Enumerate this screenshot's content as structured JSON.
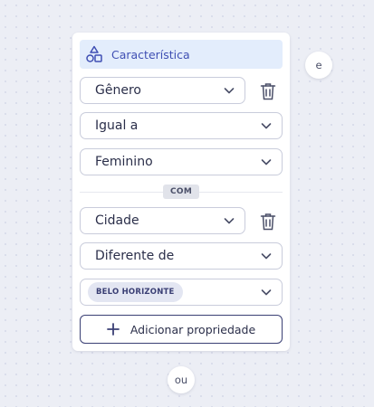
{
  "card": {
    "header": {
      "title": "Característica",
      "icon": "shapes-icon"
    },
    "condition1": {
      "property": "Gênero",
      "operator": "Igual a",
      "value": "Feminino"
    },
    "connector": "COM",
    "condition2": {
      "property": "Cidade",
      "operator": "Diferente de",
      "value_chip": "BELO HORIZONTE"
    },
    "add_button": "Adicionar propriedade"
  },
  "side_connector": "e",
  "bottom_connector": "ou",
  "colors": {
    "accent": "#3f4fb3",
    "header_bg": "#e3edfc",
    "dark": "#3a3f74",
    "background": "#eceef5"
  }
}
